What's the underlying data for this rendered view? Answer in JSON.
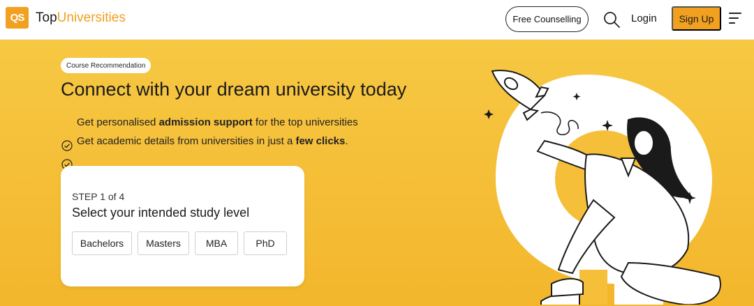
{
  "header": {
    "logo_mark": "QS",
    "logo_text_prefix": "Top",
    "logo_text_accent": "Universities",
    "free_counselling": "Free Counselling",
    "search_icon": "search-icon",
    "login": "Login",
    "sign_up": "Sign Up",
    "menu_icon": "hamburger-menu-icon"
  },
  "hero": {
    "badge": "Course Recommendation",
    "headline": "Connect with your dream university today",
    "bullets": [
      {
        "pre": "Get personalised ",
        "bold": "admission support",
        "post": " for the top universities"
      },
      {
        "pre": "Get academic details from universities in just a ",
        "bold": "few clicks",
        "post": "."
      }
    ],
    "check_icon": "check-circle-icon"
  },
  "card": {
    "step": "STEP 1 of 4",
    "title": "Select your intended study level",
    "options": [
      "Bachelors",
      "Masters",
      "MBA",
      "PhD"
    ]
  },
  "colors": {
    "brand": "#f1a01f",
    "hero_bg": "#f5bf3a",
    "text": "#1a1a1a"
  },
  "illustration": {
    "icon": "woman-launching-rocket-illustration"
  }
}
